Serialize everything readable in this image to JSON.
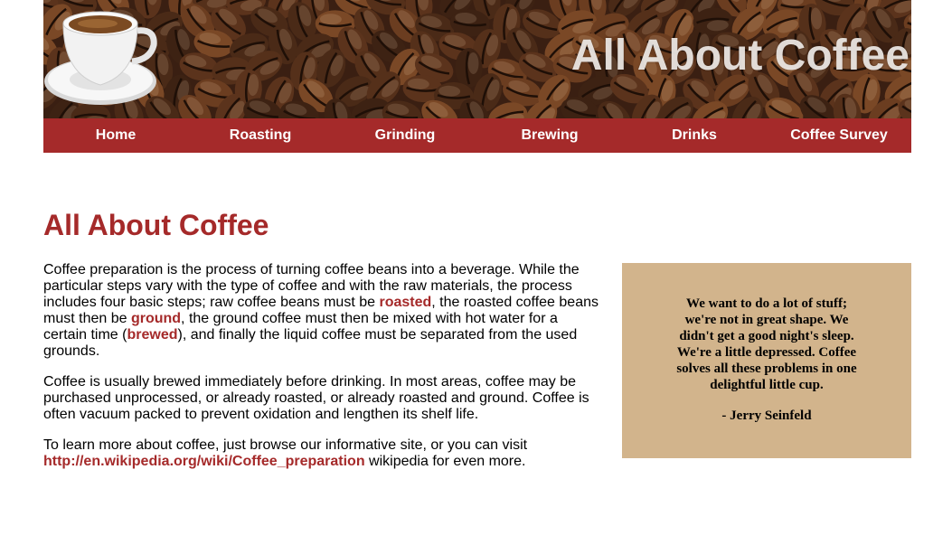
{
  "banner": {
    "title": "All About Coffee"
  },
  "nav": {
    "items": [
      {
        "label": "Home"
      },
      {
        "label": "Roasting"
      },
      {
        "label": "Grinding"
      },
      {
        "label": "Brewing"
      },
      {
        "label": "Drinks"
      },
      {
        "label": "Coffee Survey"
      }
    ]
  },
  "main": {
    "title": "All About Coffee",
    "p1": {
      "a": "Coffee preparation is the process of turning coffee beans into a beverage. While the particular steps vary with the type of coffee and with the raw materials, the process includes four basic steps; raw coffee beans must be ",
      "roasted": "roasted",
      "b": ", the roasted coffee beans must then be ",
      "ground": "ground",
      "c": ", the ground coffee must then be mixed with hot water for a certain time (",
      "brewed": "brewed",
      "d": "), and finally the liquid coffee must be separated from the used grounds."
    },
    "p2": "Coffee is usually brewed immediately before drinking. In most areas, coffee may be purchased unprocessed, or already roasted, or already roasted and ground. Coffee is often vacuum packed to prevent oxidation and lengthen its shelf life.",
    "p3": {
      "a": "To learn more about coffee, just browse our informative site, or you can visit",
      "link": "http://en.wikipedia.org/wiki/Coffee_preparation",
      "b": " wikipedia for even more."
    }
  },
  "quote": {
    "text": "We want to do a lot of stuff; we're not in great shape. We didn't get a good night's sleep. We're a little depressed. Coffee solves all these problems in one delightful little cup.",
    "author": "- Jerry Seinfeld"
  },
  "colors": {
    "accent": "#a52a2a",
    "quote_bg": "#d2b48c"
  }
}
